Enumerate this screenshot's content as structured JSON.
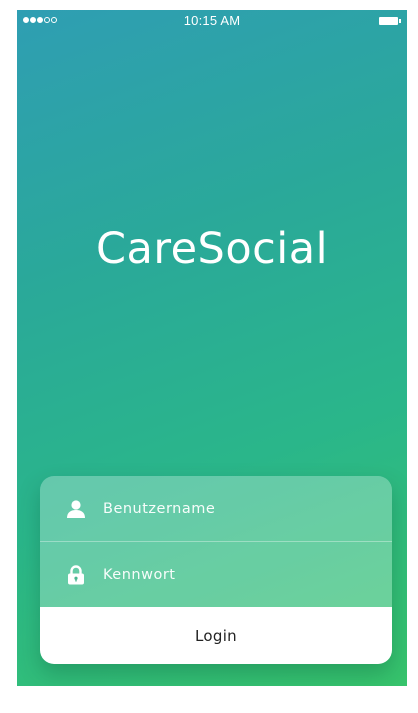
{
  "status_bar": {
    "signal_dots_filled": 3,
    "signal_dots_total": 5,
    "time": "10:15 AM",
    "battery_level": 1.0,
    "signal_icon": "signal-dots-icon",
    "battery_icon": "battery-full-icon"
  },
  "app": {
    "title": "CareSocial"
  },
  "login": {
    "username_placeholder": "Benutzername",
    "username_value": "",
    "username_icon": "user-icon",
    "password_placeholder": "Kennwort",
    "password_value": "",
    "password_icon": "lock-icon",
    "submit_label": "Login"
  },
  "colors": {
    "gradient_top": "#2f9eb3",
    "gradient_bottom": "#37c46c",
    "text": "#ffffff",
    "button_bg": "#ffffff",
    "button_text": "#222222"
  }
}
